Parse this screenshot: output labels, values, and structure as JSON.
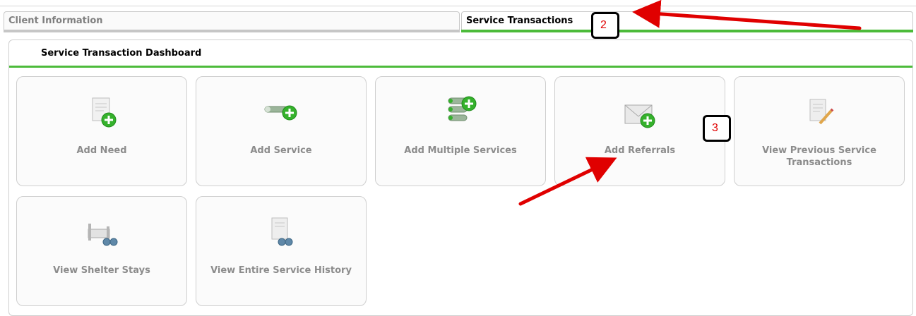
{
  "tabs": [
    {
      "label": "Client Information",
      "active": false
    },
    {
      "label": "Service Transactions",
      "active": true
    }
  ],
  "dashboard": {
    "title": "Service Transaction Dashboard",
    "tiles": [
      {
        "label": "Add Need",
        "icon": "document-add-icon"
      },
      {
        "label": "Add Service",
        "icon": "key-add-icon"
      },
      {
        "label": "Add Multiple Services",
        "icon": "multiple-keys-add-icon"
      },
      {
        "label": "Add Referrals",
        "icon": "envelope-add-icon"
      },
      {
        "label": "View Previous Service Transactions",
        "icon": "document-pencil-icon"
      },
      {
        "label": "View Shelter Stays",
        "icon": "bed-binoculars-icon"
      },
      {
        "label": "View Entire Service History",
        "icon": "document-binoculars-icon"
      }
    ]
  },
  "annotations": {
    "callout_2": "2",
    "callout_3": "3",
    "arrow_color": "#e00000"
  },
  "colors": {
    "accent_green": "#4cbb3a",
    "muted_text": "#8c8c8c"
  }
}
